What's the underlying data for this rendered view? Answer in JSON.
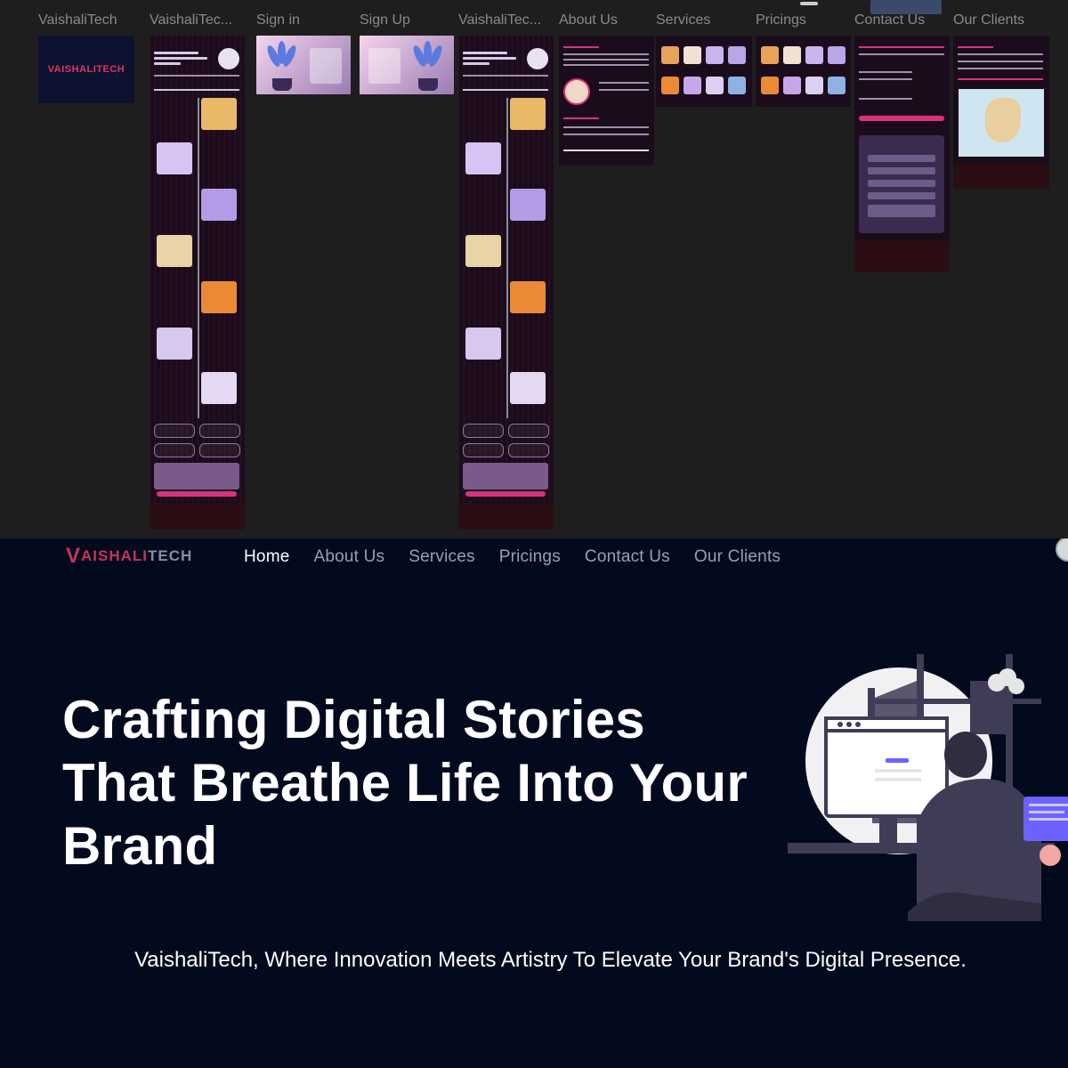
{
  "canvas": {
    "frame_labels": [
      "VaishaliTech",
      "VaishaliTec...",
      "Sign in",
      "Sign Up",
      "VaishaliTec...",
      "About Us",
      "Services",
      "Pricings",
      "Contact Us",
      "Our Clients"
    ],
    "logo_thumb_text": "VAISHALITECH"
  },
  "site": {
    "logo": {
      "first": "V",
      "mid": "AISHALI",
      "end": "TECH"
    },
    "nav": [
      "Home",
      "About Us",
      "Services",
      "Pricings",
      "Contact Us",
      "Our Clients"
    ],
    "active_nav": "Home",
    "hero_title": "Crafting Digital Stories That Breathe Life Into Your Brand",
    "hero_subtitle": "VaishaliTech, Where Innovation Meets Artistry To Elevate Your Brand's Digital Presence."
  },
  "colors": {
    "canvas_bg": "#1e1e1e",
    "site_bg": "#040a1e",
    "brand_red": "#c4355a",
    "nav_inactive": "#9aa0b2",
    "accent_purple": "#6c63ff"
  }
}
